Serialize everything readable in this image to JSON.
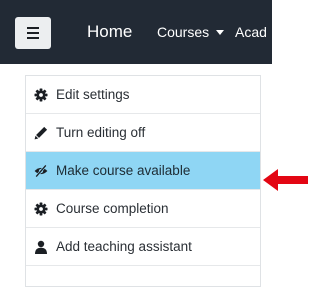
{
  "navbar": {
    "menu_icon": "hamburger-icon",
    "home_label": "Home",
    "courses_label": "Courses",
    "courses_caret_icon": "caret-down-icon",
    "academy_label": "Acad",
    "background_color": "#222a35"
  },
  "menu": {
    "items": [
      {
        "label": "Edit settings",
        "icon": "gear-icon"
      },
      {
        "label": "Turn editing off",
        "icon": "pencil-icon"
      },
      {
        "label": "Make course available",
        "icon": "eye-slash-icon",
        "highlighted": true
      },
      {
        "label": "Course completion",
        "icon": "gear-icon"
      },
      {
        "label": "Add teaching assistant",
        "icon": "user-icon"
      }
    ],
    "highlight_color": "#8fd6f4"
  },
  "annotation": {
    "icon": "arrow-left-icon",
    "color": "#e30613"
  }
}
